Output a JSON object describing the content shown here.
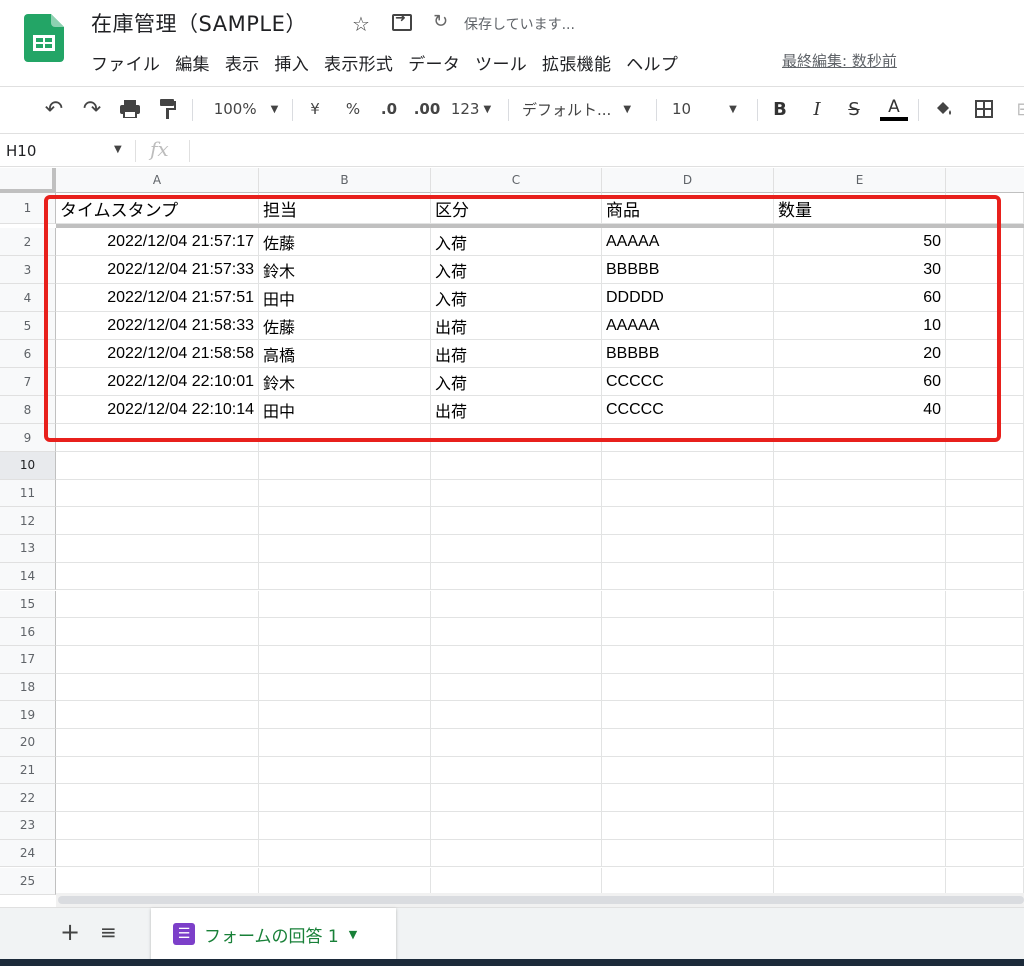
{
  "doc": {
    "title": "在庫管理（SAMPLE）",
    "save_status": "保存しています...",
    "last_edit": "最終編集: 数秒前"
  },
  "menu": [
    "ファイル",
    "編集",
    "表示",
    "挿入",
    "表示形式",
    "データ",
    "ツール",
    "拡張機能",
    "ヘルプ"
  ],
  "toolbar": {
    "zoom": "100%",
    "currency": "¥",
    "percent": "%",
    "decrease_decimal": ".0",
    "increase_decimal": ".00",
    "more_formats": "123",
    "font": "デフォルト...",
    "font_size": "10",
    "bold": "B",
    "italic": "I",
    "strike": "S",
    "text_color": "A"
  },
  "formula_bar": {
    "name_box": "H10",
    "fx": "fx"
  },
  "grid": {
    "columns": [
      "A",
      "B",
      "C",
      "D",
      "E"
    ],
    "row_numbers": [
      "1",
      "2",
      "3",
      "4",
      "5",
      "6",
      "7",
      "8",
      "9",
      "10",
      "11",
      "12",
      "13",
      "14",
      "15",
      "16",
      "17",
      "18",
      "19",
      "20",
      "21",
      "22",
      "23",
      "24",
      "25"
    ],
    "header": [
      "タイムスタンプ",
      "担当",
      "区分",
      "商品",
      "数量"
    ],
    "rows": [
      [
        "2022/12/04 21:57:17",
        "佐藤",
        "入荷",
        "AAAAA",
        "50"
      ],
      [
        "2022/12/04 21:57:33",
        "鈴木",
        "入荷",
        "BBBBB",
        "30"
      ],
      [
        "2022/12/04 21:57:51",
        "田中",
        "入荷",
        "DDDDD",
        "60"
      ],
      [
        "2022/12/04 21:58:33",
        "佐藤",
        "出荷",
        "AAAAA",
        "10"
      ],
      [
        "2022/12/04 21:58:58",
        "高橋",
        "出荷",
        "BBBBB",
        "20"
      ],
      [
        "2022/12/04 22:10:01",
        "鈴木",
        "入荷",
        "CCCCC",
        "60"
      ],
      [
        "2022/12/04 22:10:14",
        "田中",
        "出荷",
        "CCCCC",
        "40"
      ]
    ]
  },
  "sheet_tab": {
    "label": "フォームの回答 1"
  },
  "colors": {
    "accent": "#188038",
    "highlight": "#e8201c",
    "form_icon": "#7c3fc9"
  }
}
